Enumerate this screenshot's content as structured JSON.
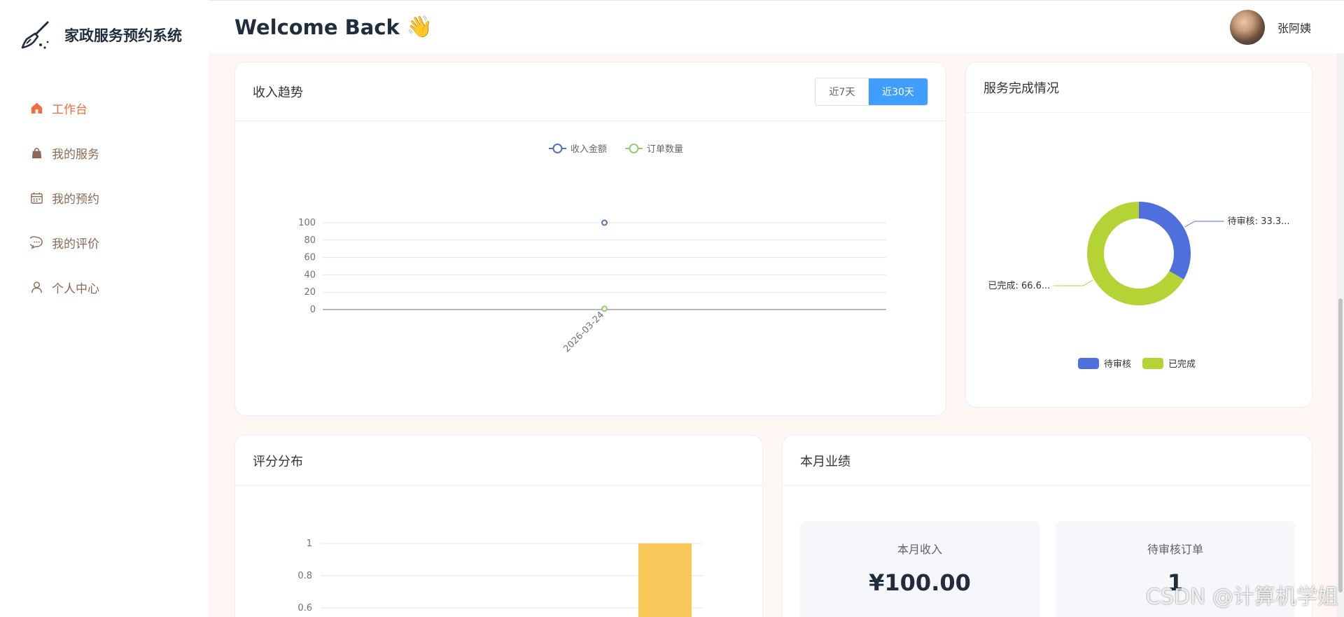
{
  "app": {
    "title": "家政服务预约系统"
  },
  "sidebar": {
    "items": [
      {
        "label": "工作台",
        "icon": "home-icon",
        "active": true
      },
      {
        "label": "我的服务",
        "icon": "shopping-bag-icon",
        "active": false
      },
      {
        "label": "我的预约",
        "icon": "calendar-icon",
        "active": false
      },
      {
        "label": "我的评价",
        "icon": "chat-bubble-icon",
        "active": false
      },
      {
        "label": "个人中心",
        "icon": "user-icon",
        "active": false
      }
    ]
  },
  "header": {
    "welcome": "Welcome Back",
    "wave_emoji": "👋",
    "user_name": "张阿姨"
  },
  "income_card": {
    "title": "收入趋势",
    "range_options": [
      "近7天",
      "近30天"
    ],
    "selected_range": "近30天"
  },
  "service_card": {
    "title": "服务完成情况"
  },
  "rating_card": {
    "title": "评分分布"
  },
  "month_card": {
    "title": "本月业绩",
    "stats": [
      {
        "label": "本月收入",
        "value": "¥100.00"
      },
      {
        "label": "待审核订单",
        "value": "1"
      }
    ]
  },
  "watermark": "CSDN @计算机学姐",
  "chart_data": [
    {
      "type": "line",
      "title": "",
      "x": [
        "2026-03-24"
      ],
      "series": [
        {
          "name": "收入金额",
          "values": [
            100
          ],
          "color": "#5470c6"
        },
        {
          "name": "订单数量",
          "values": [
            1
          ],
          "color": "#91cc75"
        }
      ],
      "ylim": [
        0,
        100
      ],
      "yticks": [
        0,
        20,
        40,
        60,
        80,
        100
      ],
      "legend": "top",
      "grid": true
    },
    {
      "type": "pie",
      "title": "",
      "slices": [
        {
          "name": "待审核",
          "value": 1,
          "label": "待审核: 33.3...",
          "color": "#4f6fdc"
        },
        {
          "name": "已完成",
          "value": 2,
          "label": "已完成: 66.6...",
          "color": "#b5d334"
        }
      ],
      "legend": "bottom"
    },
    {
      "type": "bar",
      "title": "",
      "yticks_visible": [
        0.6,
        0.8,
        1
      ],
      "ylim": [
        0,
        1
      ],
      "values_visible": [
        1
      ],
      "color": "#f8c75a",
      "grid": true
    }
  ]
}
